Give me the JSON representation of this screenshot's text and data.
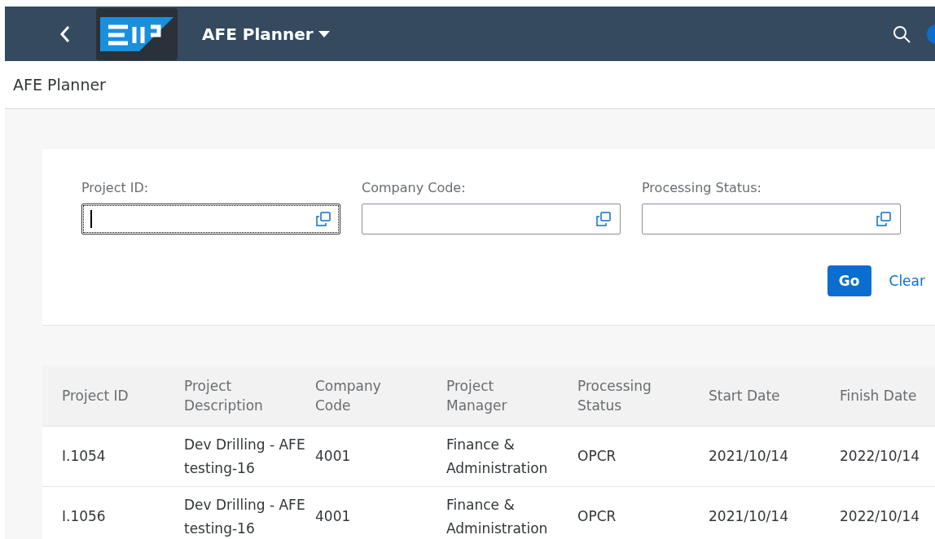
{
  "shell_bar": {
    "title": "AFE Planner"
  },
  "page_title": "AFE Planner",
  "filters": [
    {
      "label": "Project ID:",
      "focused": true
    },
    {
      "label": "Company Code:",
      "focused": false
    },
    {
      "label": "Processing Status:",
      "focused": false
    }
  ],
  "actions": {
    "go": "Go",
    "clear": "Clear"
  },
  "table": {
    "columns": [
      "Project ID",
      "Project Description",
      "Company Code",
      "Project Manager",
      "Processing Status",
      "Start Date",
      "Finish Date"
    ],
    "rows": [
      [
        "I.1054",
        "Dev Drilling - AFE testing-16",
        "4001",
        "Finance & Administration",
        "OPCR",
        "2021/10/14",
        "2022/10/14"
      ],
      [
        "I.1056",
        "Dev Drilling - AFE testing-16",
        "4001",
        "Finance & Administration",
        "OPCR",
        "2021/10/14",
        "2022/10/14"
      ]
    ]
  }
}
